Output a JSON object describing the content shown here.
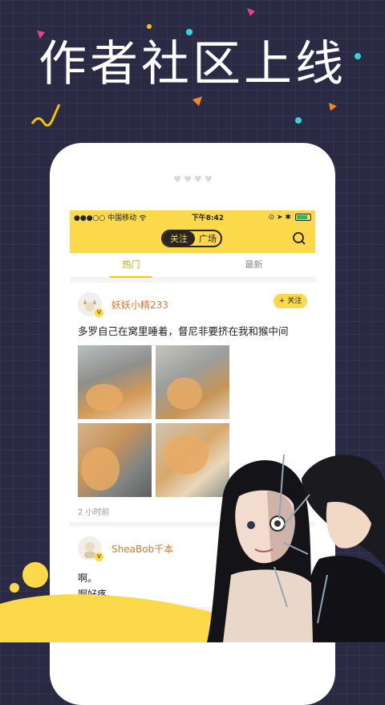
{
  "banner": {
    "headline": "作者社区上线"
  },
  "phone": {
    "speaker_dots": "♥♥♥♥"
  },
  "status_bar": {
    "carrier": "●●●○○ 中国移动",
    "wifi": "wifi-icon",
    "time": "下午8:42",
    "right_icons": "⊙ ➤ ✱",
    "battery_icon": "battery-icon"
  },
  "nav": {
    "segment_follow": "关注",
    "segment_square": "广场",
    "search_icon": "search-icon"
  },
  "tabs": {
    "hot": "热门",
    "latest": "最新"
  },
  "posts": [
    {
      "username": "妖妖小精233",
      "verified": "V",
      "follow_label": "+ 关注",
      "text": "多罗自己在窝里睡着，督尼非要挤在我和猴中间",
      "time": "2 小时前"
    },
    {
      "username": "SheaBob千本",
      "verified": "V",
      "text_line1": "啊。",
      "text_line2": "啊好疼。"
    }
  ],
  "colors": {
    "accent_yellow": "#fbd94a",
    "background": "#2b2a45",
    "username": "#e0752a"
  }
}
